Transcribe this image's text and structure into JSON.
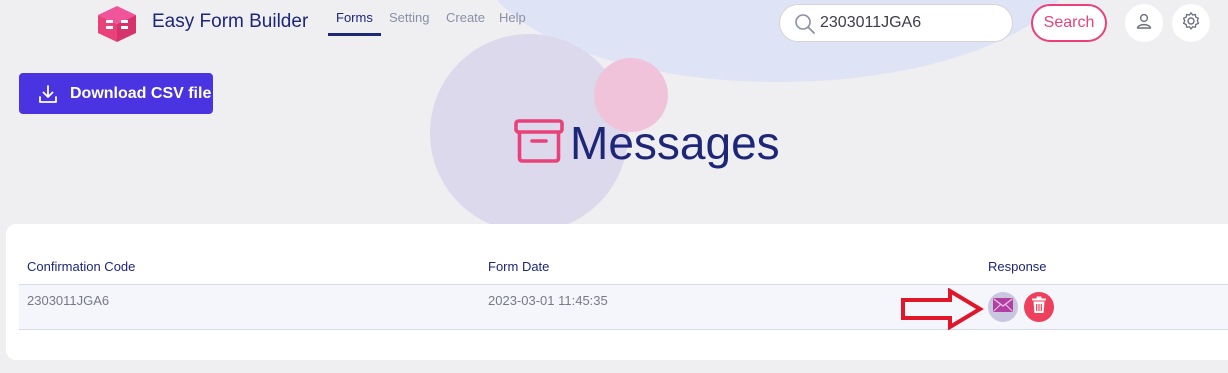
{
  "brand": {
    "name": "Easy Form Builder",
    "logo": "efb-cube-logo"
  },
  "nav": {
    "items": [
      {
        "label": "Forms",
        "active": true
      },
      {
        "label": "Setting",
        "active": false
      },
      {
        "label": "Create",
        "active": false
      },
      {
        "label": "Help",
        "active": false
      }
    ]
  },
  "search": {
    "value": "2303011JGA6",
    "button_label": "Search",
    "icon": "search-icon"
  },
  "header_icons": {
    "user": "user-icon",
    "settings": "gear-icon"
  },
  "toolbar": {
    "download_label": "Download CSV file",
    "download_icon": "download-icon"
  },
  "page": {
    "title": "Messages",
    "title_icon": "archive-box-icon"
  },
  "table": {
    "columns": [
      "Confirmation Code",
      "Form Date",
      "Response"
    ],
    "rows": [
      {
        "confirmation_code": "2303011JGA6",
        "form_date": "2023-03-01 11:45:35",
        "actions": [
          "envelope-icon",
          "trash-icon"
        ]
      }
    ]
  },
  "annotation": {
    "icon": "red-arrow-icon"
  },
  "colors": {
    "primary": "#1e2678",
    "accent_pink": "#e9417a",
    "download_button": "#4a33e0",
    "delete": "#ee3f5c",
    "view": "#c9c7df",
    "arrow": "#e0162b"
  }
}
